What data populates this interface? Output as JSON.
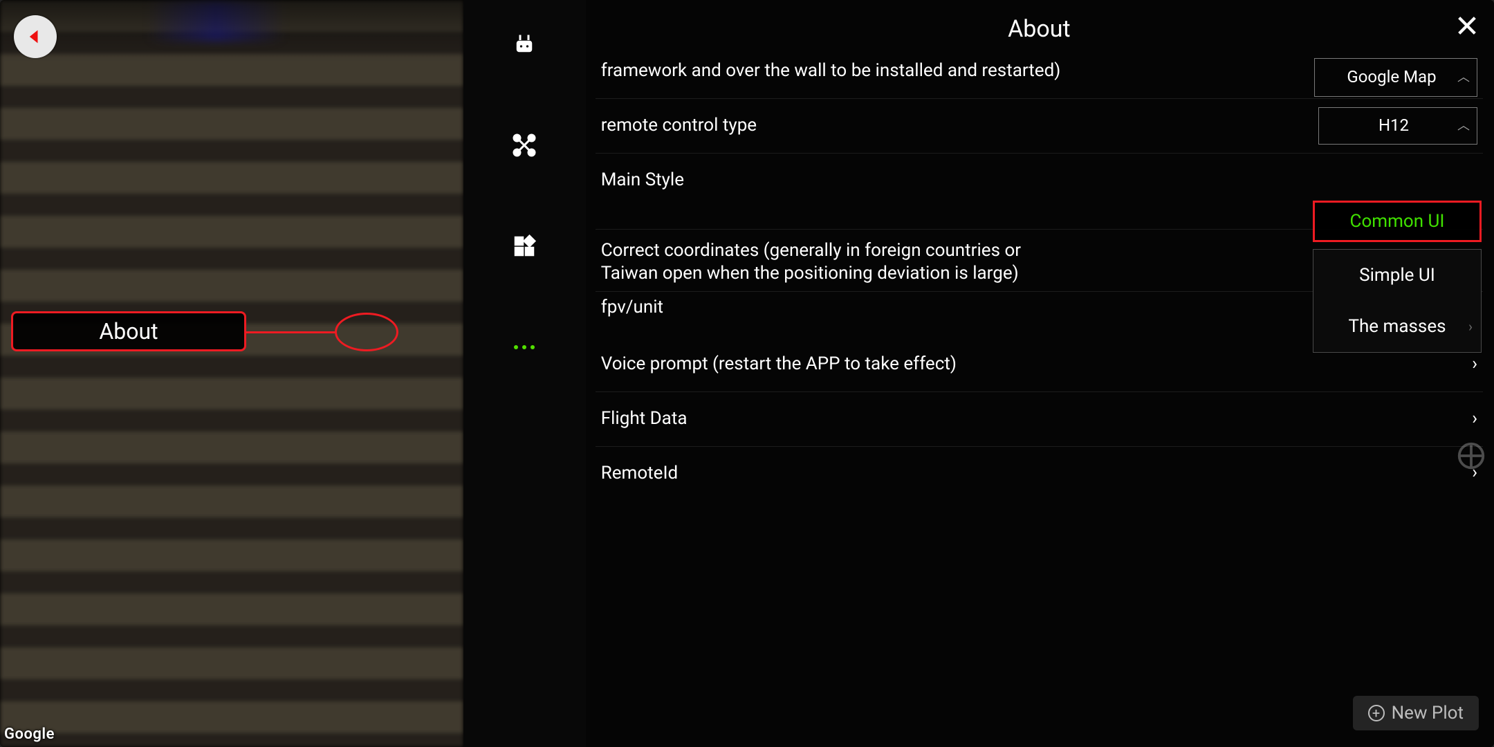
{
  "map": {
    "attribution": "Google"
  },
  "back": {
    "aria": "Back"
  },
  "annotation": {
    "label": "About"
  },
  "rail": {
    "icons": [
      "robot-icon",
      "drone-icon",
      "apps-icon",
      "more-icon"
    ]
  },
  "panel": {
    "title": "About",
    "close_aria": "Close",
    "items": {
      "map_provider": {
        "label": "framework and over the wall to be installed and restarted)",
        "value": "Google Map"
      },
      "remote_type": {
        "label": "remote control type",
        "value": "H12"
      },
      "main_style": {
        "label": "Main Style",
        "value": "Common UI",
        "options": [
          "Common UI",
          "Simple UI",
          "The masses"
        ]
      },
      "correct_coords": {
        "label": "Correct coordinates (generally in foreign countries or Taiwan open when the positioning deviation is large)",
        "toggle": true
      },
      "fpv": {
        "label": "fpv/unit"
      },
      "voice": {
        "label": "Voice prompt (restart the APP to take effect)"
      },
      "flight_data": {
        "label": "Flight Data"
      },
      "remote_id": {
        "label": "RemoteId"
      }
    }
  },
  "newplot": {
    "label": "New Plot"
  }
}
